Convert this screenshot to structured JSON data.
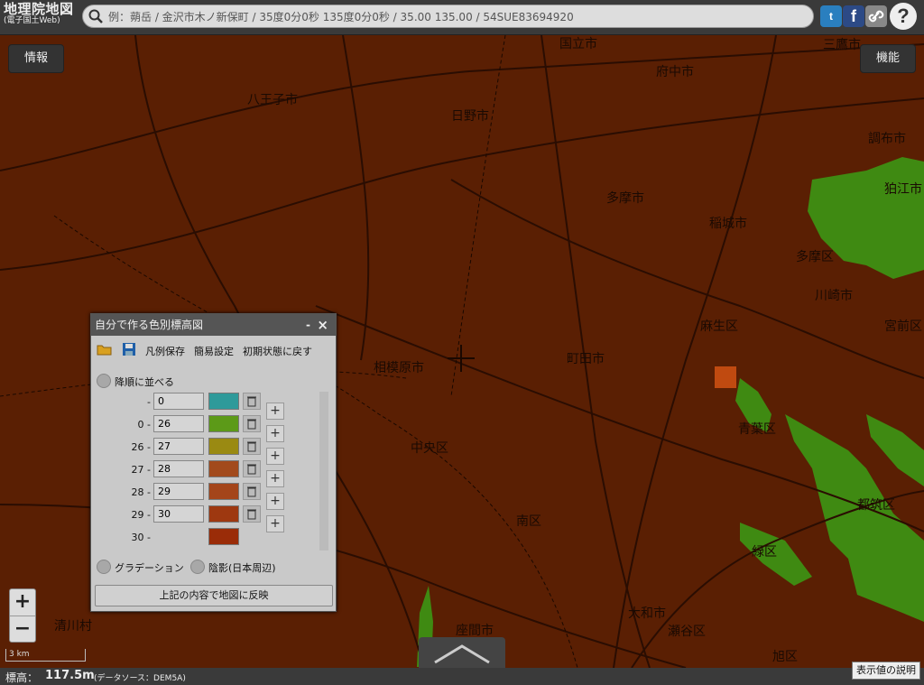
{
  "header": {
    "logo_line1": "地理院地図",
    "logo_line2": "(電子国土Web)",
    "search_placeholder": "例：蒴岳 / 金沢市木ノ新保町 / 35度0分0秒 135度0分0秒 / 35.00 135.00 / 54SUE83694920",
    "twitter_icon": "twitter-icon",
    "facebook_icon": "facebook-icon",
    "link_icon": "link-icon",
    "help_icon": "help-icon",
    "twitter_glyph": "t",
    "facebook_glyph": "f",
    "help_glyph": "?"
  },
  "map": {
    "info_button": "情報",
    "function_button": "機能",
    "labels": [
      "八王子市",
      "日野市",
      "国立市",
      "府中市",
      "三鷹市",
      "調布市",
      "狛江市",
      "多摩市",
      "稲城市",
      "多摩区",
      "相模原市",
      "町田市",
      "麻生区",
      "宮前区",
      "青葉区",
      "都筑区",
      "中央区",
      "南区",
      "緑区",
      "清川村",
      "大和市",
      "瀬谷区",
      "旭区",
      "座間市",
      "川崎市"
    ],
    "colors": {
      "base": "#5a1f03",
      "green": "#3f8a12",
      "orange": "#c04a10"
    }
  },
  "dialog": {
    "title": "自分で作る色別標高図",
    "min": "-",
    "close": "×",
    "save_legend": "凡例保存",
    "easy_settings": "簡易設定",
    "reset": "初期状態に戻す",
    "descending": "降順に並べる",
    "rows": [
      {
        "lower": "",
        "sep": "-",
        "upper": "0",
        "color": "#2e9a9a"
      },
      {
        "lower": "0",
        "sep": "-",
        "upper": "26",
        "color": "#5c9a18"
      },
      {
        "lower": "26",
        "sep": "-",
        "upper": "27",
        "color": "#9a8a12"
      },
      {
        "lower": "27",
        "sep": "-",
        "upper": "28",
        "color": "#a24a1c"
      },
      {
        "lower": "28",
        "sep": "-",
        "upper": "29",
        "color": "#a4451a"
      },
      {
        "lower": "29",
        "sep": "-",
        "upper": "30",
        "color": "#9e3810"
      },
      {
        "lower": "30",
        "sep": "-",
        "upper": "",
        "color": "#9a2c08"
      }
    ],
    "gradation": "グラデーション",
    "shading": "陰影(日本周辺)",
    "apply": "上記の内容で地図に反映"
  },
  "zoom": {
    "in": "+",
    "out": "−"
  },
  "scale": "3 km",
  "footer": {
    "elevation_label": "標高：",
    "elevation_value": "117.5m",
    "source": "(データソース：DEM5A)",
    "explain": "表示値の説明"
  }
}
